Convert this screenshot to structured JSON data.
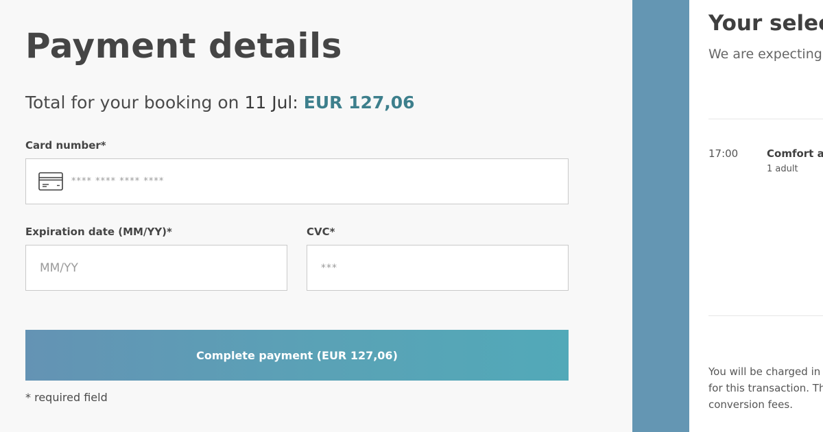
{
  "payment": {
    "title": "Payment details",
    "total_prefix": "Total for your booking on ",
    "total_date": "11 Jul:",
    "total_amount": "EUR 127,06",
    "card_label": "Card number*",
    "card_placeholder": "**** **** **** ****",
    "card_icon": "credit-card-icon",
    "expiry_label": "Expiration date (MM/YY)*",
    "expiry_placeholder": "MM/YY",
    "cvc_label": "CVC*",
    "cvc_placeholder": "***",
    "submit_label": "Complete payment (EUR 127,06)",
    "required_note": "* required field"
  },
  "selection": {
    "title": "Your selec",
    "subtitle": "We are expecting y",
    "time": "17:00",
    "product": "Comfort ad",
    "passengers": "1 adult",
    "charge_note_line1": "You will be charged in E",
    "charge_note_line2": "for this transaction. Th",
    "charge_note_line3": "conversion fees."
  },
  "colors": {
    "accent": "#3d7f8c",
    "band": "#6496b3",
    "button_start": "#6493b4",
    "button_end": "#52a9b8"
  }
}
